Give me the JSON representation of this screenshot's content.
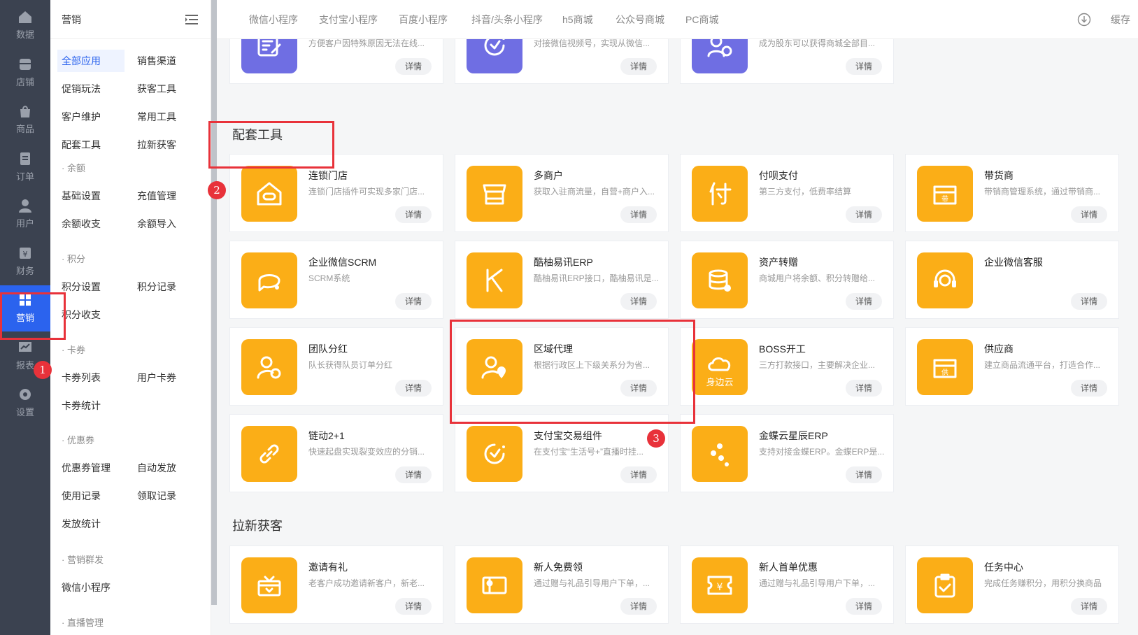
{
  "rail": [
    {
      "label": "数据",
      "icon": "home-icon"
    },
    {
      "label": "店铺",
      "icon": "store-icon"
    },
    {
      "label": "商品",
      "icon": "bag-icon"
    },
    {
      "label": "订单",
      "icon": "document-icon"
    },
    {
      "label": "用户",
      "icon": "user-icon"
    },
    {
      "label": "财务",
      "icon": "yen-icon"
    },
    {
      "label": "营销",
      "icon": "apps-icon"
    },
    {
      "label": "报表",
      "icon": "chart-icon"
    },
    {
      "label": "设置",
      "icon": "gear-icon"
    }
  ],
  "submenu": {
    "title": "营销",
    "top_links": [
      "全部应用",
      "销售渠道",
      "促销玩法",
      "获客工具",
      "客户维护",
      "常用工具",
      "配套工具",
      "拉新获客"
    ],
    "groups": [
      {
        "title": "· 余额",
        "links": [
          "基础设置",
          "充值管理",
          "余额收支",
          "余额导入"
        ]
      },
      {
        "title": "· 积分",
        "links": [
          "积分设置",
          "积分记录",
          "积分收支"
        ]
      },
      {
        "title": "· 卡券",
        "links": [
          "卡券列表",
          "用户卡券",
          "卡券统计"
        ]
      },
      {
        "title": "· 优惠券",
        "links": [
          "优惠券管理",
          "自动发放",
          "使用记录",
          "领取记录",
          "发放统计"
        ]
      },
      {
        "title": "· 营销群发",
        "links": [
          "微信小程序"
        ]
      },
      {
        "title": "· 直播管理",
        "links": []
      }
    ]
  },
  "top_tabs": [
    "微信小程序",
    "支付宝小程序",
    "百度小程序",
    "抖音/头条小程序",
    "h5商城",
    "公众号商城",
    "PC商城"
  ],
  "cache_label": "缓存",
  "detail_label": "详情",
  "top_cards": [
    {
      "desc": "方便客户因特殊原因无法在线...",
      "icon": "edit-icon",
      "color": "purple"
    },
    {
      "desc": "对接微信视频号，实现从微信...",
      "icon": "video-sync-icon",
      "color": "purple"
    },
    {
      "desc": "成为股东可以获得商城全部目...",
      "icon": "shareholder-icon",
      "color": "purple"
    }
  ],
  "section_tools": {
    "title": "配套工具",
    "cards": [
      {
        "name": "连锁门店",
        "desc": "连锁门店插件可实现多家门店...",
        "icon": "chain-store-icon"
      },
      {
        "name": "多商户",
        "desc": "获取入驻商流量，自营+商户入...",
        "icon": "multi-merchant-icon"
      },
      {
        "name": "付呗支付",
        "desc": "第三方支付，低费率结算",
        "icon": "fubei-pay-icon"
      },
      {
        "name": "带货商",
        "desc": "带销商管理系统，通过带销商...",
        "icon": "sales-shop-icon"
      },
      {
        "name": "企业微信SCRM",
        "desc": "SCRM系统",
        "icon": "chat-icon"
      },
      {
        "name": "酷柚易讯ERP",
        "desc": "酷柚易讯ERP接口，酷柚易讯是...",
        "icon": "erp-logo-icon"
      },
      {
        "name": "资产转赠",
        "desc": "商城用户将余额、积分转赠给...",
        "icon": "asset-transfer-icon"
      },
      {
        "name": "企业微信客服",
        "desc": "",
        "icon": "headset-icon"
      },
      {
        "name": "团队分红",
        "desc": "队长获得队员订单分红",
        "icon": "team-bonus-icon"
      },
      {
        "name": "区域代理",
        "desc": "根据行政区上下级关系分为省...",
        "icon": "area-agent-icon"
      },
      {
        "name": "BOSS开工",
        "desc": "三方打款接口，主要解决企业...",
        "icon": "cloud-icon",
        "icon_text": "身边云"
      },
      {
        "name": "供应商",
        "desc": "建立商品流通平台，打造合作...",
        "icon": "supplier-icon"
      },
      {
        "name": "链动2+1",
        "desc": "快速起盘实现裂变效应的分销...",
        "icon": "link-icon"
      },
      {
        "name": "支付宝交易组件",
        "desc": "在支付宝“生活号+”直播时挂...",
        "icon": "alipay-component-icon"
      },
      {
        "name": "金蝶云星辰ERP",
        "desc": "支持对接金蝶ERP。金蝶ERP是...",
        "icon": "dots-icon"
      }
    ]
  },
  "section_acquire": {
    "title": "拉新获客",
    "cards": [
      {
        "name": "邀请有礼",
        "desc": "老客户成功邀请新客户，新老...",
        "icon": "gift-icon"
      },
      {
        "name": "新人免费领",
        "desc": "通过赠与礼品引导用户下单，...",
        "icon": "free-gift-icon"
      },
      {
        "name": "新人首单优惠",
        "desc": "通过赠与礼品引导用户下单，...",
        "icon": "coupon-icon"
      },
      {
        "name": "任务中心",
        "desc": "完成任务赚积分，用积分换商品",
        "icon": "task-icon"
      }
    ]
  },
  "markers": [
    "1",
    "2",
    "3"
  ],
  "colors": {
    "accent": "#2b63ee",
    "icon_orange": "#fbae17",
    "icon_purple": "#6f6ee3",
    "annotation_red": "#e8323a"
  }
}
